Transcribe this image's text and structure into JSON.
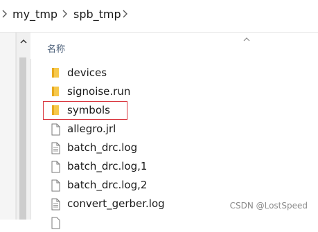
{
  "breadcrumb": {
    "items": [
      "my_tmp",
      "spb_tmp"
    ]
  },
  "column_header": {
    "name_label": "名称"
  },
  "files": [
    {
      "name": "devices",
      "icon": "folder-icon",
      "type": "folder"
    },
    {
      "name": "signoise.run",
      "icon": "folder-icon",
      "type": "folder"
    },
    {
      "name": "symbols",
      "icon": "folder-icon",
      "type": "folder",
      "highlighted": true
    },
    {
      "name": "allegro.jrl",
      "icon": "file-icon",
      "type": "file"
    },
    {
      "name": "batch_drc.log",
      "icon": "text-file-icon",
      "type": "file"
    },
    {
      "name": "batch_drc.log,1",
      "icon": "file-icon",
      "type": "file"
    },
    {
      "name": "batch_drc.log,2",
      "icon": "file-icon",
      "type": "file"
    },
    {
      "name": "convert_gerber.log",
      "icon": "text-file-icon",
      "type": "file"
    }
  ],
  "watermark": "CSDN @LostSpeed",
  "colors": {
    "folder": "#f2c04b",
    "highlight_border": "#d9363e",
    "header_text": "#4c607a"
  }
}
